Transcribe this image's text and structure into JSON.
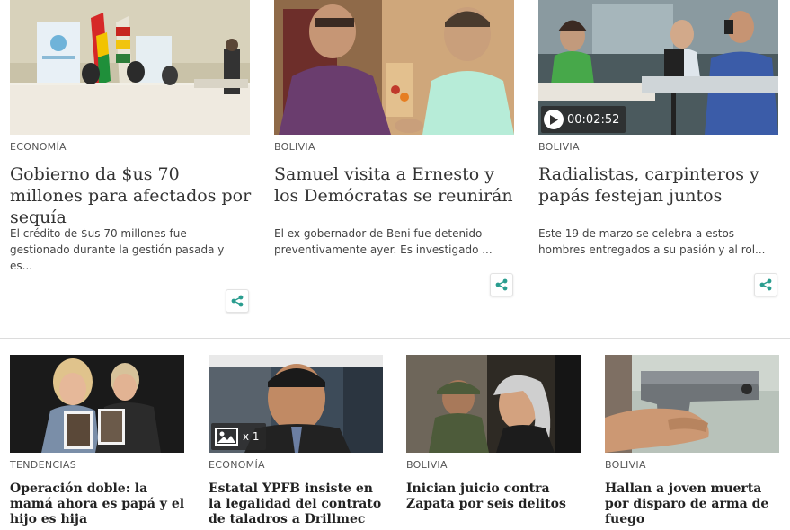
{
  "top_cards": [
    {
      "category": "ECONOMÍA",
      "title": "Gobierno da $us 70 millones para afectados por sequía",
      "summary": "El crédito de $us 70 millones fue gestionado durante la gestión pasada y es..."
    },
    {
      "category": "BOLIVIA",
      "title": "Samuel visita a Ernesto y los Demócratas se reunirán",
      "summary": "El ex gobernador de Beni fue detenido preventivamente ayer. Es investigado ..."
    },
    {
      "category": "BOLIVIA",
      "title": "Radialistas, carpinteros y papás festejan juntos",
      "summary": "Este 19 de marzo se celebra a estos hombres entregados a su pasión y al rol...",
      "video_duration": "00:02:52"
    }
  ],
  "bottom_cards": [
    {
      "category": "TENDENCIAS",
      "title": "Operación doble: la mamá ahora es papá y el hijo es hija"
    },
    {
      "category": "ECONOMÍA",
      "title": "Estatal YPFB insiste en la legalidad del contrato de taladros a Drillmec",
      "gallery_count": "x 1"
    },
    {
      "category": "BOLIVIA",
      "title": "Inician juicio contra Zapata por seis delitos"
    },
    {
      "category": "BOLIVIA",
      "title": "Hallan a joven muerta por disparo de arma de fuego"
    }
  ],
  "icons": {
    "share": "share-icon",
    "play": "play-icon",
    "gallery": "image-gallery-icon"
  },
  "colors": {
    "share_accent": "#2a9d8f",
    "category_text": "#555555",
    "divider": "#dcdcdc"
  }
}
